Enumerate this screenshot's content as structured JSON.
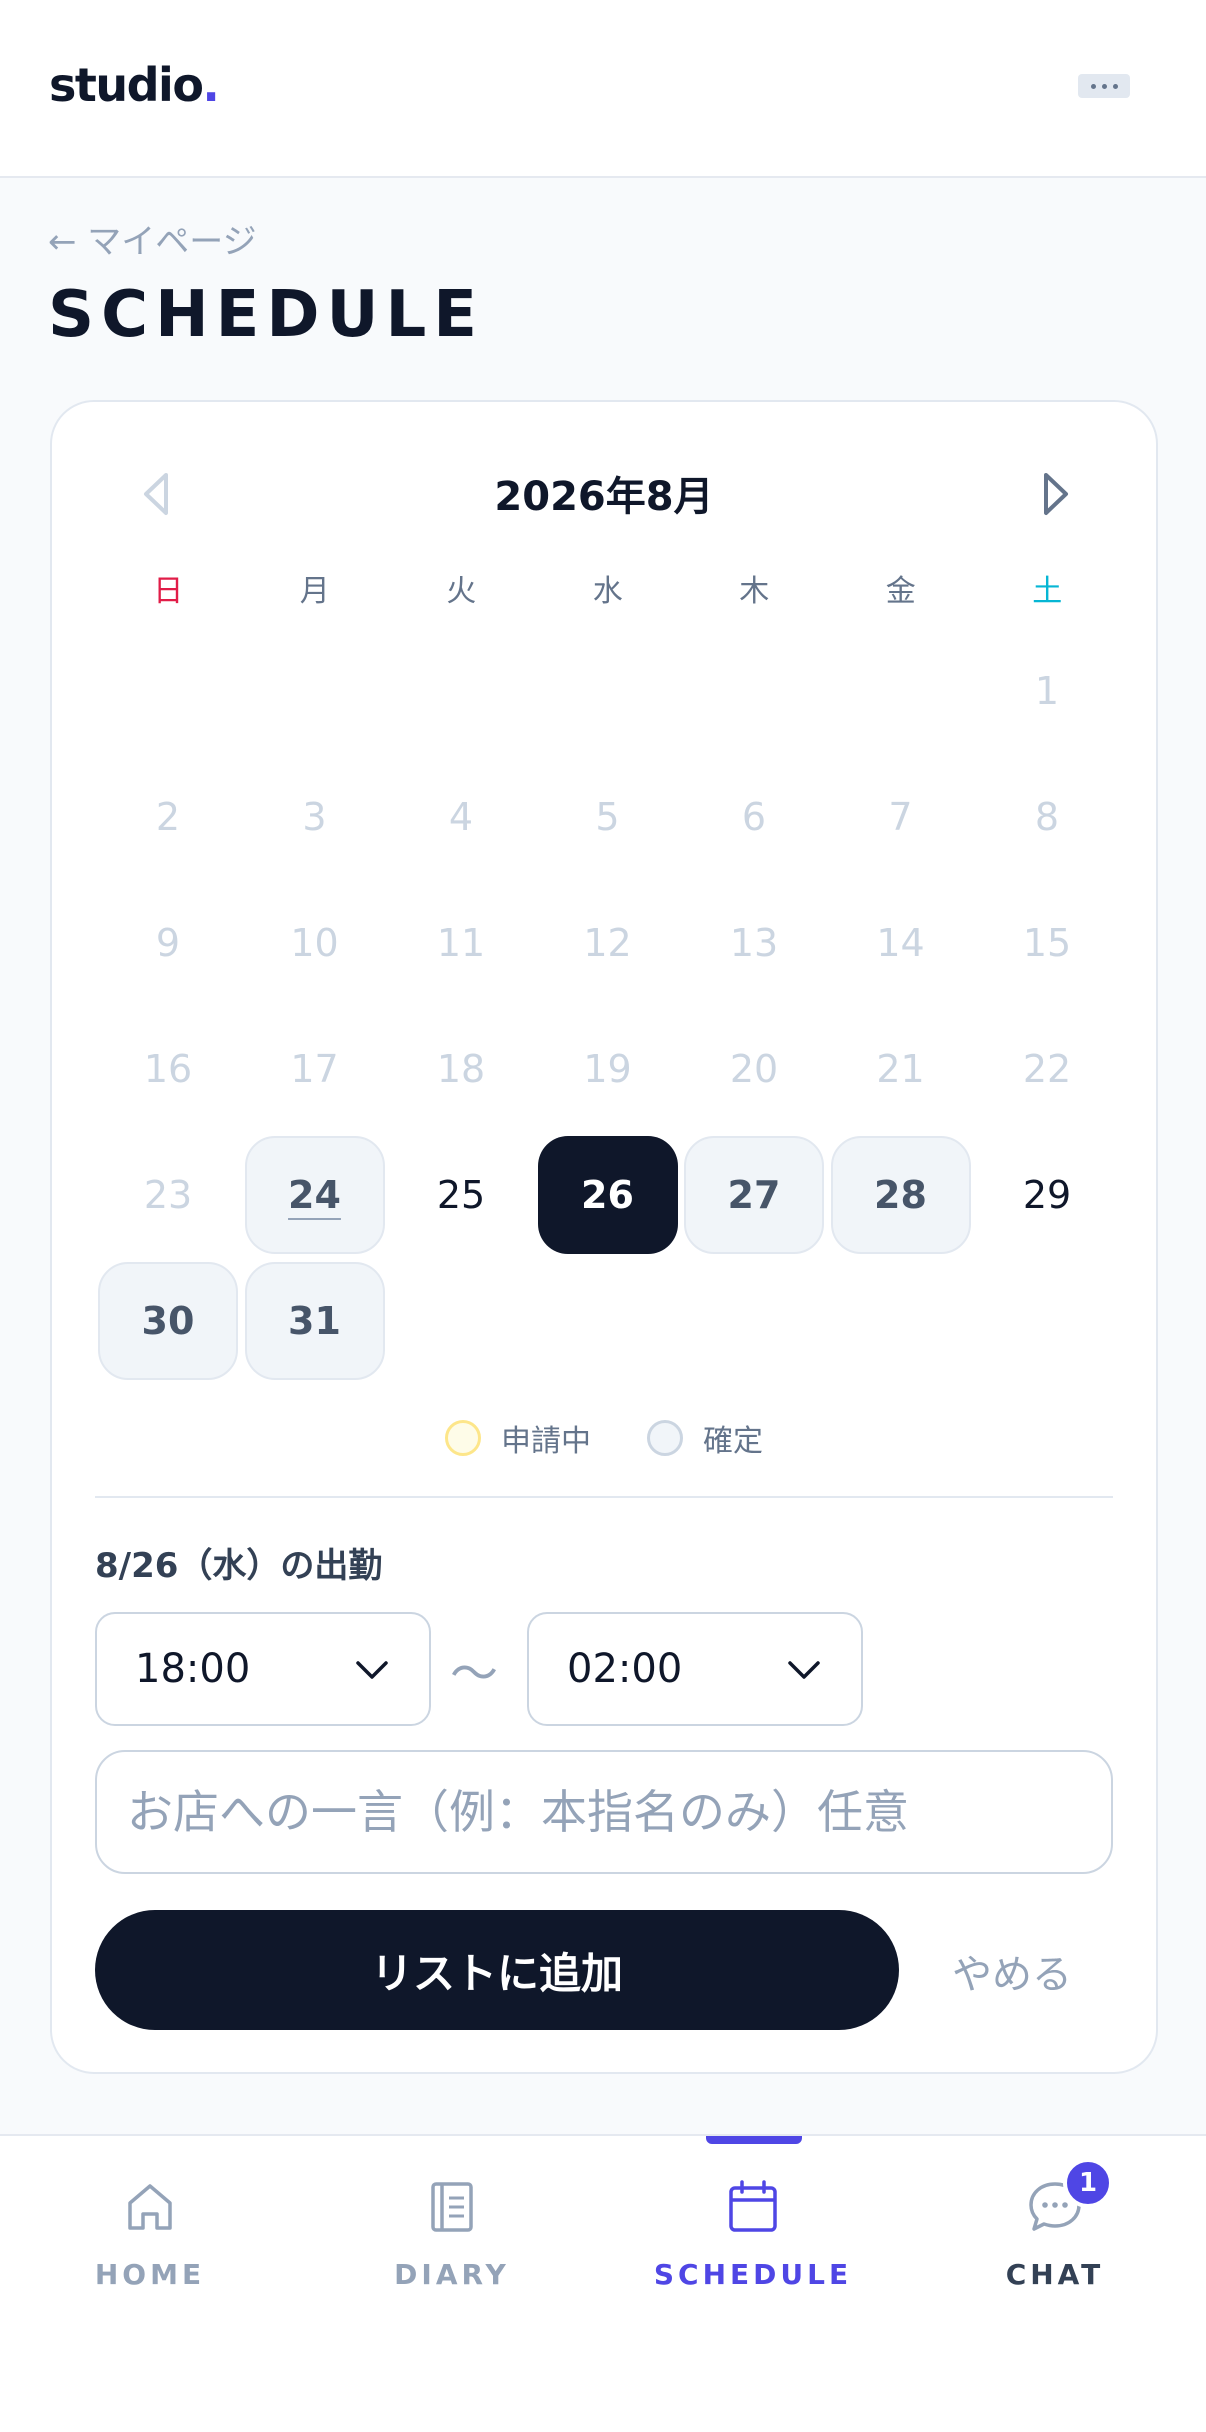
{
  "header": {
    "logo_text": "studio",
    "logo_dot": ".",
    "menu_icon": "more-horizontal-icon"
  },
  "page": {
    "back_label": "← マイページ",
    "title": "SCHEDULE"
  },
  "calendar": {
    "month_title": "2026年8月",
    "weekdays": [
      "日",
      "月",
      "火",
      "水",
      "木",
      "金",
      "土"
    ],
    "days": [
      {
        "label": "",
        "state": "blank"
      },
      {
        "label": "",
        "state": "blank"
      },
      {
        "label": "",
        "state": "blank"
      },
      {
        "label": "",
        "state": "blank"
      },
      {
        "label": "",
        "state": "blank"
      },
      {
        "label": "",
        "state": "blank"
      },
      {
        "label": "1",
        "state": "past"
      },
      {
        "label": "2",
        "state": "past"
      },
      {
        "label": "3",
        "state": "past"
      },
      {
        "label": "4",
        "state": "past"
      },
      {
        "label": "5",
        "state": "past"
      },
      {
        "label": "6",
        "state": "past"
      },
      {
        "label": "7",
        "state": "past"
      },
      {
        "label": "8",
        "state": "past"
      },
      {
        "label": "9",
        "state": "past"
      },
      {
        "label": "10",
        "state": "past"
      },
      {
        "label": "11",
        "state": "past"
      },
      {
        "label": "12",
        "state": "past"
      },
      {
        "label": "13",
        "state": "past"
      },
      {
        "label": "14",
        "state": "past"
      },
      {
        "label": "15",
        "state": "past"
      },
      {
        "label": "16",
        "state": "past"
      },
      {
        "label": "17",
        "state": "past"
      },
      {
        "label": "18",
        "state": "past"
      },
      {
        "label": "19",
        "state": "past"
      },
      {
        "label": "20",
        "state": "past"
      },
      {
        "label": "21",
        "state": "past"
      },
      {
        "label": "22",
        "state": "past"
      },
      {
        "label": "23",
        "state": "past"
      },
      {
        "label": "24",
        "state": "confirmed-today"
      },
      {
        "label": "25",
        "state": "available"
      },
      {
        "label": "26",
        "state": "selected"
      },
      {
        "label": "27",
        "state": "confirmed"
      },
      {
        "label": "28",
        "state": "confirmed"
      },
      {
        "label": "29",
        "state": "available"
      },
      {
        "label": "30",
        "state": "confirmed"
      },
      {
        "label": "31",
        "state": "confirmed"
      }
    ],
    "legend": {
      "applying": "申請中",
      "confirmed": "確定"
    }
  },
  "shift": {
    "label": "8/26（水）の出勤",
    "start_time": "18:00",
    "separator": "〜",
    "end_time": "02:00",
    "note_placeholder": "お店への一言（例：本指名のみ）任意",
    "add_label": "リストに追加",
    "cancel_label": "やめる"
  },
  "bottom_nav": {
    "items": [
      {
        "label": "HOME",
        "icon": "home-icon"
      },
      {
        "label": "DIARY",
        "icon": "diary-icon"
      },
      {
        "label": "SCHEDULE",
        "icon": "calendar-icon",
        "active": true
      },
      {
        "label": "CHAT",
        "icon": "chat-icon"
      }
    ],
    "chat_badge": "1"
  },
  "colors": {
    "accent": "#4f46e5",
    "dark": "#0f172a",
    "sunday": "#e11d48",
    "saturday": "#06b6d4"
  }
}
